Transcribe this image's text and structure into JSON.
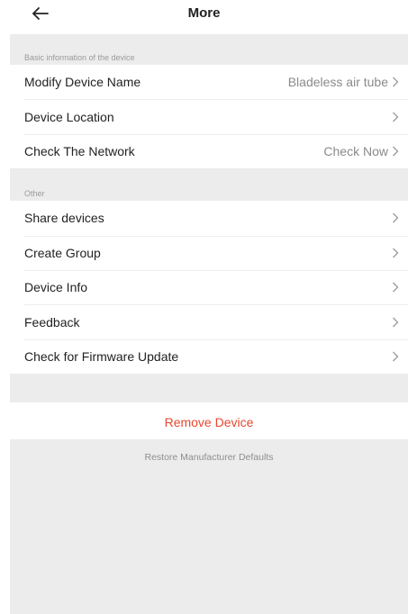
{
  "header": {
    "title": "More",
    "back_icon": "arrow-left-icon"
  },
  "sections": [
    {
      "label": "Basic information of the device",
      "items": [
        {
          "label": "Modify Device Name",
          "value": "Bladeless air tube"
        },
        {
          "label": "Device Location",
          "value": ""
        },
        {
          "label": "Check The Network",
          "value": "Check Now"
        }
      ]
    },
    {
      "label": "Other",
      "items": [
        {
          "label": "Share devices",
          "value": ""
        },
        {
          "label": "Create Group",
          "value": ""
        },
        {
          "label": "Device Info",
          "value": ""
        },
        {
          "label": "Feedback",
          "value": ""
        },
        {
          "label": "Check for Firmware Update",
          "value": ""
        }
      ]
    }
  ],
  "actions": {
    "remove_label": "Remove Device",
    "restore_label": "Restore Manufacturer Defaults"
  },
  "colors": {
    "danger": "#e8472f",
    "section_bg": "#ececec",
    "muted_text": "#8a8a8a"
  },
  "icons": {
    "row_chevron": "chevron-right-icon"
  }
}
